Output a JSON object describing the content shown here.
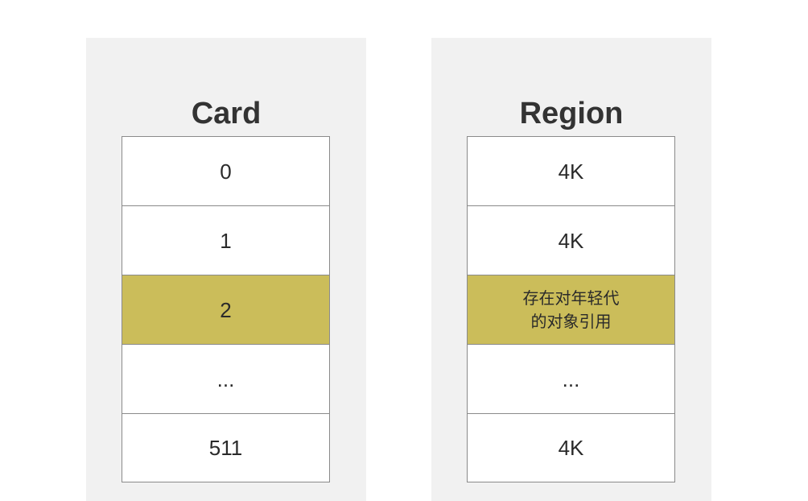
{
  "card_panel": {
    "title": "Card",
    "cells": [
      {
        "label": "0",
        "highlighted": false
      },
      {
        "label": "1",
        "highlighted": false
      },
      {
        "label": "2",
        "highlighted": true
      },
      {
        "label": "...",
        "highlighted": false
      },
      {
        "label": "511",
        "highlighted": false
      }
    ]
  },
  "region_panel": {
    "title": "Region",
    "cells": [
      {
        "label": "4K",
        "highlighted": false
      },
      {
        "label": "4K",
        "highlighted": false
      },
      {
        "label": "存在对年轻代\n的对象引用",
        "highlighted": true
      },
      {
        "label": "...",
        "highlighted": false
      },
      {
        "label": "4K",
        "highlighted": false
      }
    ]
  },
  "colors": {
    "panel_background": "#f1f1f1",
    "highlight": "#cbbd5a",
    "cell_border": "#8a8a8a",
    "text": "#333333"
  }
}
